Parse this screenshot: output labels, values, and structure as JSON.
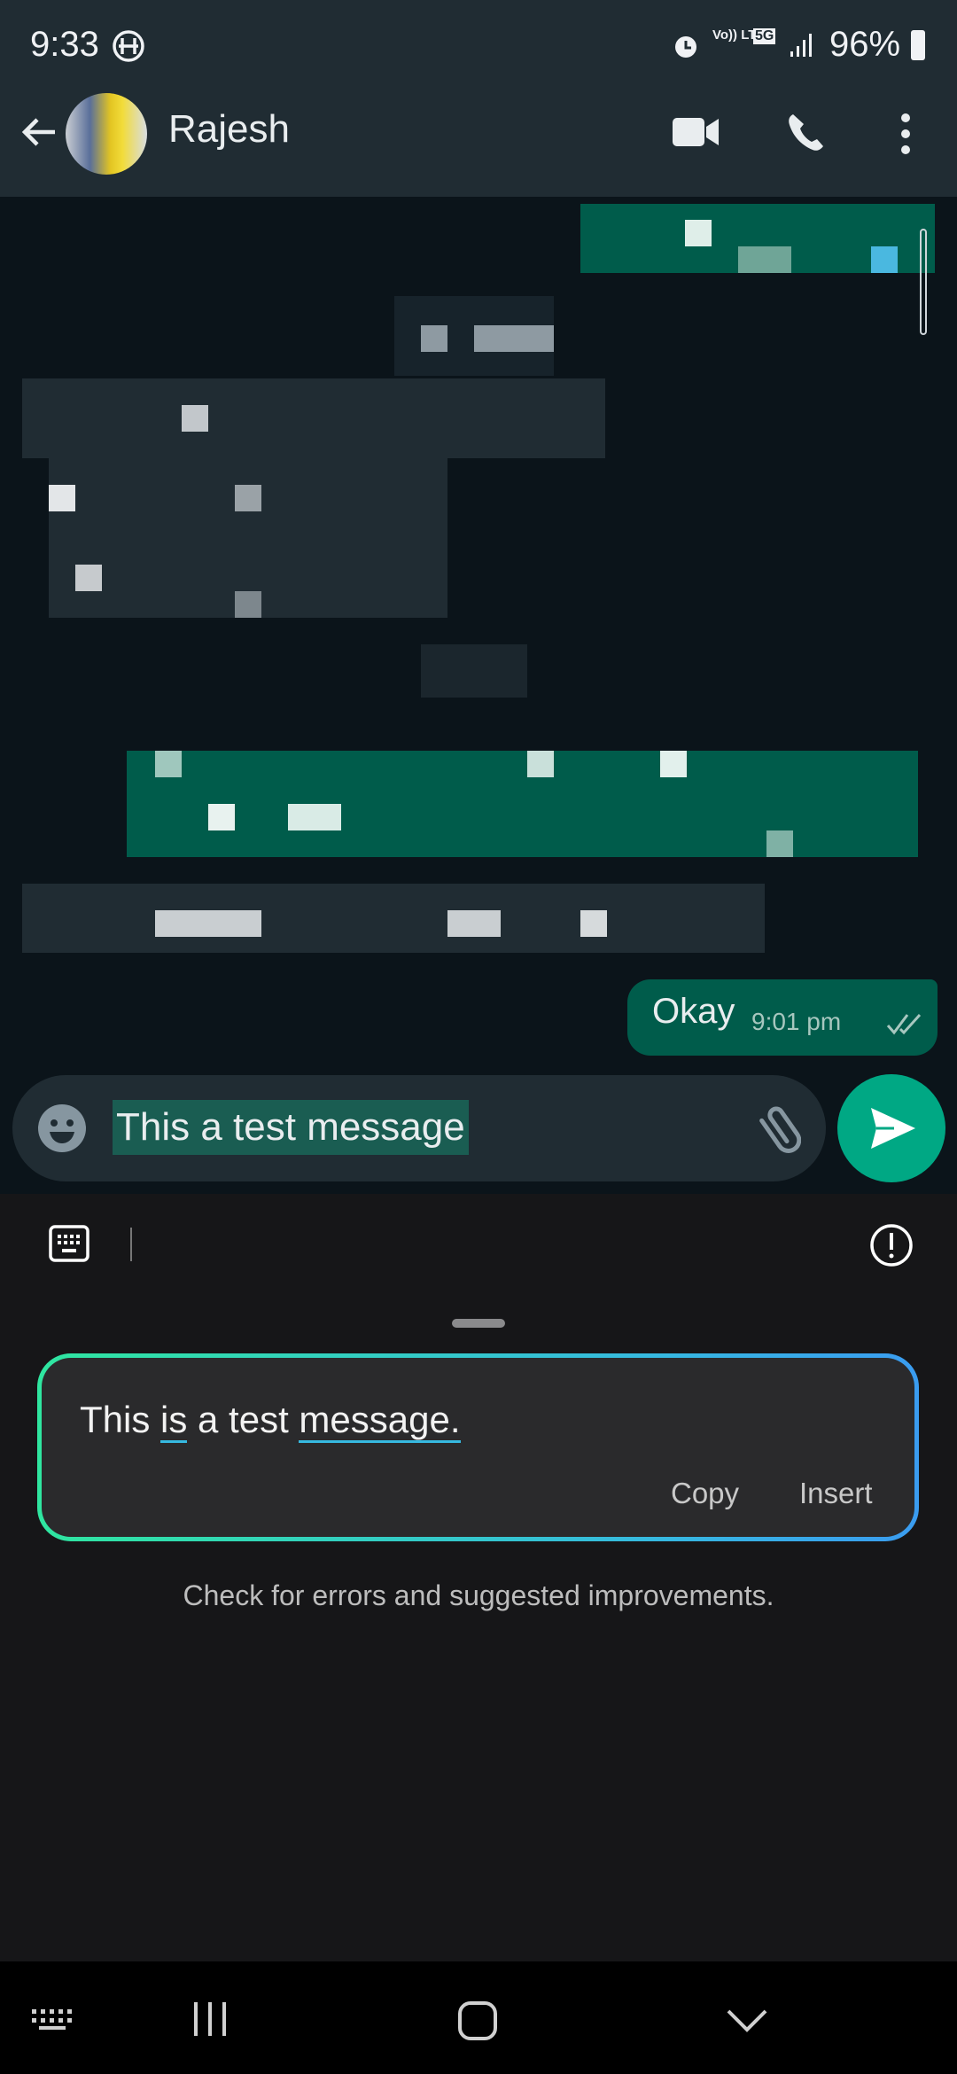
{
  "status_bar": {
    "time": "9:33",
    "battery": "96%",
    "network": "5G",
    "volte": "Vo)) LTE"
  },
  "header": {
    "contact_name": "Rajesh"
  },
  "chat": {
    "messages": [
      {
        "direction": "out",
        "text": "Okay",
        "time": "9:01 pm",
        "status": "read"
      }
    ]
  },
  "composer": {
    "text": "This a test message"
  },
  "writing_assist": {
    "suggestion_parts": [
      "This ",
      "is",
      " a test ",
      "message."
    ],
    "copy_label": "Copy",
    "insert_label": "Insert",
    "hint": "Check for errors and suggested improvements."
  },
  "colors": {
    "accent": "#00a884",
    "bubble_out": "#005c4b",
    "header": "#202c33",
    "gradient_start": "#2fe6a0",
    "gradient_end": "#3a9cf0"
  }
}
